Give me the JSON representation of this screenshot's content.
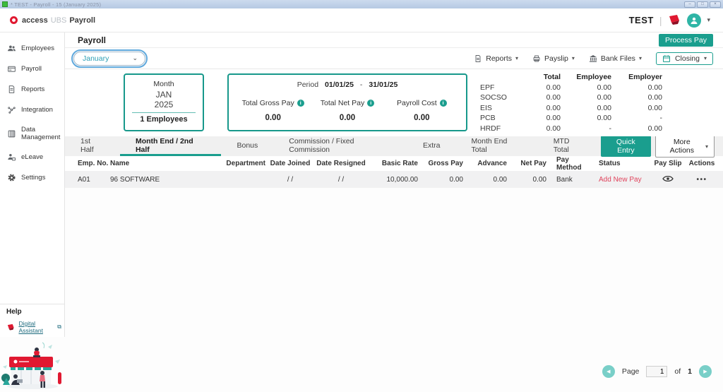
{
  "window": {
    "title": "* TEST - Payroll -   15 (January 2025)"
  },
  "header": {
    "brand_access": "access",
    "brand_ubs": "UBS",
    "brand_product": "Payroll",
    "company": "TEST"
  },
  "sidebar": {
    "items": [
      {
        "label": "Employees"
      },
      {
        "label": "Payroll"
      },
      {
        "label": "Reports"
      },
      {
        "label": "Integration"
      },
      {
        "label": "Data Management"
      },
      {
        "label": "eLeave"
      },
      {
        "label": "Settings"
      }
    ],
    "help_heading": "Help",
    "assistant_label": "Digital Assistant"
  },
  "page": {
    "title": "Payroll",
    "process_pay_label": "Process Pay"
  },
  "toolbar": {
    "month": "January",
    "reports_label": "Reports",
    "payslip_label": "Payslip",
    "bank_files_label": "Bank Files",
    "closing_label": "Closing"
  },
  "summary": {
    "month_card": {
      "label": "Month",
      "month": "JAN",
      "year": "2025",
      "employees": "1 Employees"
    },
    "period_card": {
      "label": "Period",
      "from": "01/01/25",
      "separator": "-",
      "to": "31/01/25",
      "metrics": [
        {
          "label": "Total Gross Pay",
          "value": "0.00"
        },
        {
          "label": "Total Net Pay",
          "value": "0.00"
        },
        {
          "label": "Payroll Cost",
          "value": "0.00"
        }
      ]
    },
    "statutory": {
      "headers": [
        "Total",
        "Employee",
        "Employer"
      ],
      "rows": [
        {
          "label": "EPF",
          "total": "0.00",
          "employee": "0.00",
          "employer": "0.00"
        },
        {
          "label": "SOCSO",
          "total": "0.00",
          "employee": "0.00",
          "employer": "0.00"
        },
        {
          "label": "EIS",
          "total": "0.00",
          "employee": "0.00",
          "employer": "0.00"
        },
        {
          "label": "PCB",
          "total": "0.00",
          "employee": "0.00",
          "employer": "-"
        },
        {
          "label": "HRDF",
          "total": "0.00",
          "employee": "-",
          "employer": "0.00"
        }
      ]
    }
  },
  "tabs": {
    "items": [
      "1st Half",
      "Month End / 2nd Half",
      "Bonus",
      "Commission / Fixed Commission",
      "Extra",
      "Month End Total",
      "MTD Total"
    ],
    "active": "Month End / 2nd Half",
    "quick_entry_label": "Quick Entry",
    "more_actions_label": "More Actions"
  },
  "table": {
    "columns": [
      "Emp. No.",
      "Name",
      "Department",
      "Date Joined",
      "Date Resigned",
      "Basic Rate",
      "Gross Pay",
      "Advance",
      "Net Pay",
      "Pay Method",
      "Status",
      "Pay Slip",
      "Actions"
    ],
    "rows": [
      {
        "emp_no": "A01",
        "name": "96 SOFTWARE",
        "department": "",
        "date_joined": "/ /",
        "date_resigned": "/ /",
        "basic_rate": "10,000.00",
        "gross_pay": "0.00",
        "advance": "0.00",
        "net_pay": "0.00",
        "pay_method": "Bank",
        "status": "Add New Pay"
      }
    ]
  },
  "pagination": {
    "label": "Page",
    "value": "1",
    "of_label": "of",
    "total": "1"
  },
  "icons": {
    "caret_down": "▾",
    "chevron_down": "⌄",
    "actions_ellipsis": "•••",
    "prev_arrow": "◀",
    "next_arrow": "▶",
    "info": "i",
    "minimize": "–",
    "restore": "□",
    "close": "×",
    "external_link": "⧉"
  },
  "colors": {
    "accent_teal": "#1a9e8e",
    "brand_red": "#e01931",
    "status_red": "#e0435c",
    "titlebar_blue": "#bfd1e8"
  }
}
